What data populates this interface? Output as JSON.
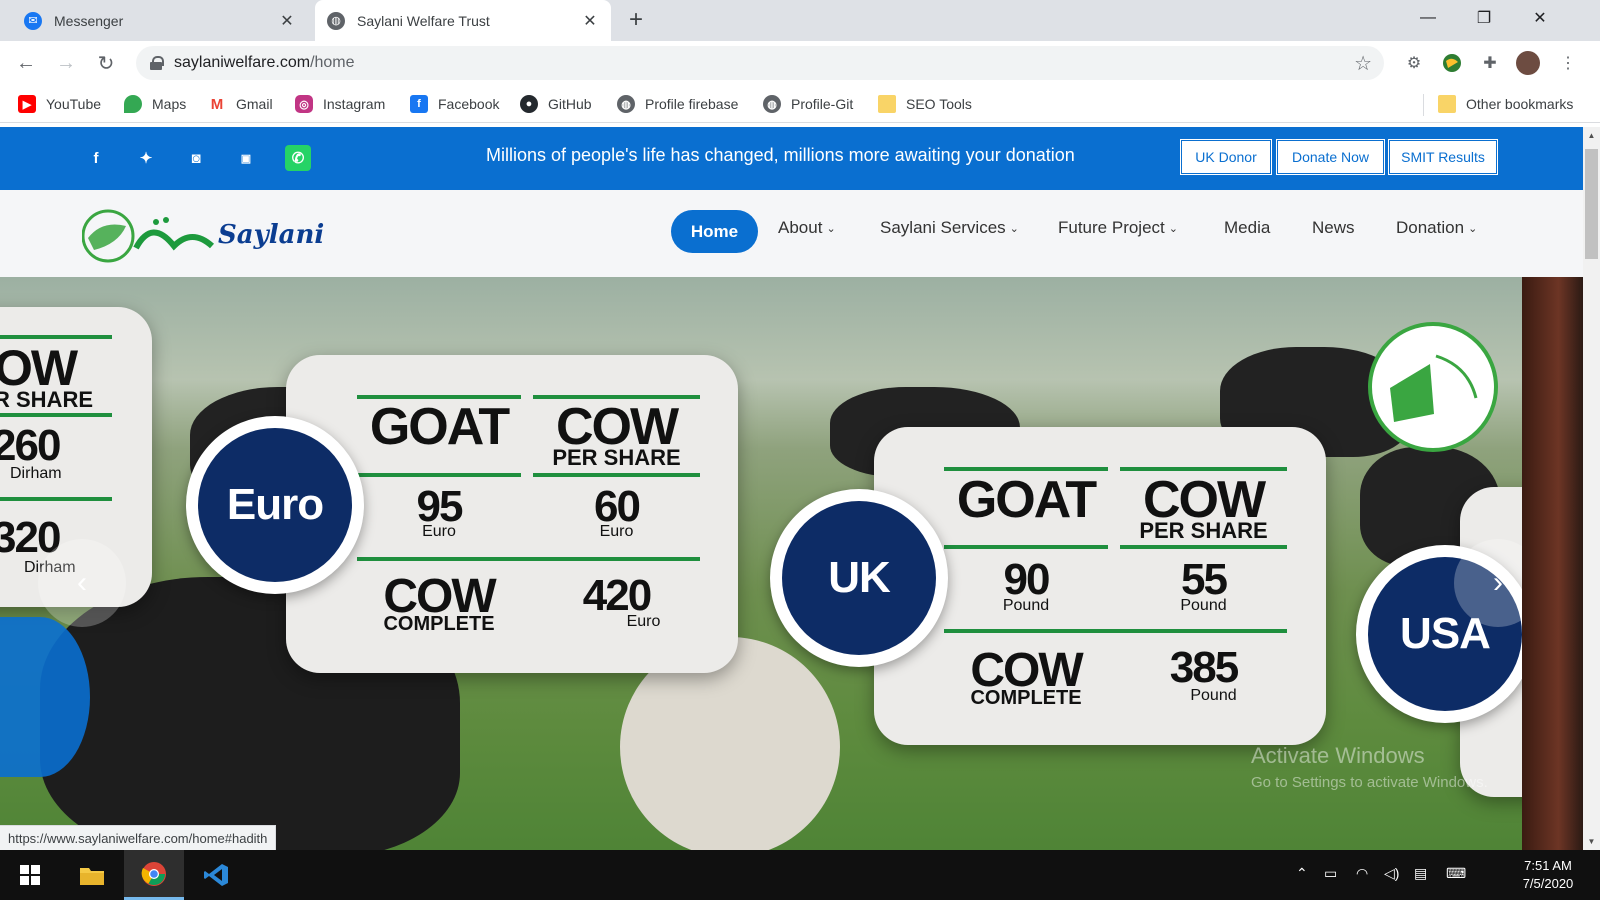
{
  "browser": {
    "tabs": [
      {
        "title": "Messenger",
        "active": false
      },
      {
        "title": "Saylani Welfare Trust",
        "active": true
      }
    ],
    "url_host": "saylaniwelfare.com",
    "url_path": "/home",
    "bookmarks": [
      "YouTube",
      "Maps",
      "Gmail",
      "Instagram",
      "Facebook",
      "GitHub",
      "Profile firebase",
      "Profile-Git",
      "SEO Tools"
    ],
    "other_bookmarks": "Other bookmarks",
    "status_url": "https://www.saylaniwelfare.com/home#hadith"
  },
  "site": {
    "tagline": "Millions of people's life has changed, millions more awaiting your donation",
    "top_buttons": [
      "UK Donor",
      "Donate Now",
      "SMIT Results"
    ],
    "logo_text": "Saylani",
    "nav": [
      "Home",
      "About",
      "Saylani Services",
      "Future Project",
      "Media",
      "News",
      "Donation"
    ],
    "social": [
      "facebook-icon",
      "twitter-icon",
      "instagram-icon",
      "youtube-icon",
      "whatsapp-icon"
    ]
  },
  "slider": {
    "left_card": {
      "head": "OW",
      "sub": "R SHARE",
      "v1": "260",
      "u1": "Dirham",
      "v2": "320",
      "u2": "Dirham"
    },
    "euro": {
      "badge": "Euro",
      "goat_label": "GOAT",
      "cow_label": "COW",
      "per_share": "PER SHARE",
      "goat_value": "95",
      "goat_unit": "Euro",
      "share_value": "60",
      "share_unit": "Euro",
      "complete_label": "COMPLETE",
      "complete_value": "420",
      "complete_unit": "Euro"
    },
    "uk": {
      "badge": "UK",
      "goat_label": "GOAT",
      "cow_label": "COW",
      "per_share": "PER SHARE",
      "goat_value": "90",
      "goat_unit": "Pound",
      "share_value": "55",
      "share_unit": "Pound",
      "complete_label": "COMPLETE",
      "complete_value": "385",
      "complete_unit": "Pound"
    },
    "usa_badge": "USA",
    "prev_arrow": "‹",
    "next_arrow": "›",
    "watermark_title": "Activate Windows",
    "watermark_sub": "Go to Settings to activate Windows."
  },
  "taskbar": {
    "time": "7:51 AM",
    "date": "7/5/2020"
  },
  "colors": {
    "brand_blue": "#0a6fd0",
    "badge_navy": "#0d2c66",
    "accent_green": "#1f8f3e"
  }
}
